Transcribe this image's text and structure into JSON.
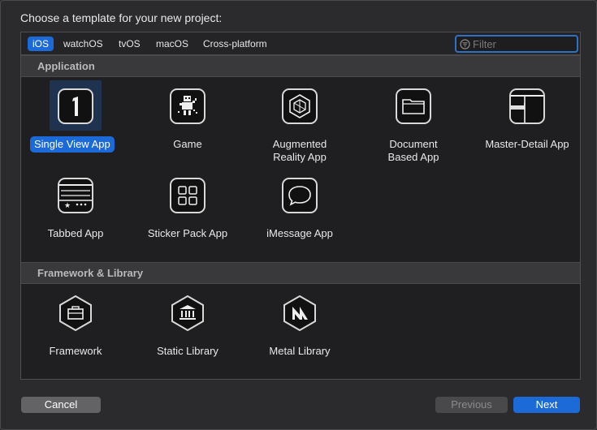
{
  "heading": "Choose a template for your new project:",
  "tabs": [
    {
      "label": "iOS",
      "active": true
    },
    {
      "label": "watchOS",
      "active": false
    },
    {
      "label": "tvOS",
      "active": false
    },
    {
      "label": "macOS",
      "active": false
    },
    {
      "label": "Cross-platform",
      "active": false
    }
  ],
  "filter": {
    "placeholder": "Filter",
    "value": ""
  },
  "sections": {
    "application": {
      "title": "Application",
      "items": [
        {
          "label": "Single View App",
          "icon": "number-one-icon",
          "selected": true
        },
        {
          "label": "Game",
          "icon": "game-robot-icon"
        },
        {
          "label": "Augmented Reality App",
          "line1": "Augmented",
          "line2": "Reality App",
          "icon": "ar-cube-icon"
        },
        {
          "label": "Document Based App",
          "line1": "Document",
          "line2": "Based App",
          "icon": "folder-icon"
        },
        {
          "label": "Master-Detail App",
          "icon": "split-view-icon"
        },
        {
          "label": "Tabbed App",
          "icon": "tab-bar-icon"
        },
        {
          "label": "Sticker Pack App",
          "icon": "grid-icon"
        },
        {
          "label": "iMessage App",
          "icon": "speech-bubble-icon"
        }
      ]
    },
    "framework": {
      "title": "Framework & Library",
      "items": [
        {
          "label": "Framework",
          "icon": "toolbox-icon"
        },
        {
          "label": "Static Library",
          "icon": "building-columns-icon"
        },
        {
          "label": "Metal Library",
          "icon": "metal-icon"
        }
      ]
    }
  },
  "buttons": {
    "cancel": "Cancel",
    "previous": "Previous",
    "next": "Next"
  },
  "colors": {
    "accent": "#1b6ad8",
    "panel": "#1f1f21",
    "section_header": "#39393b"
  }
}
